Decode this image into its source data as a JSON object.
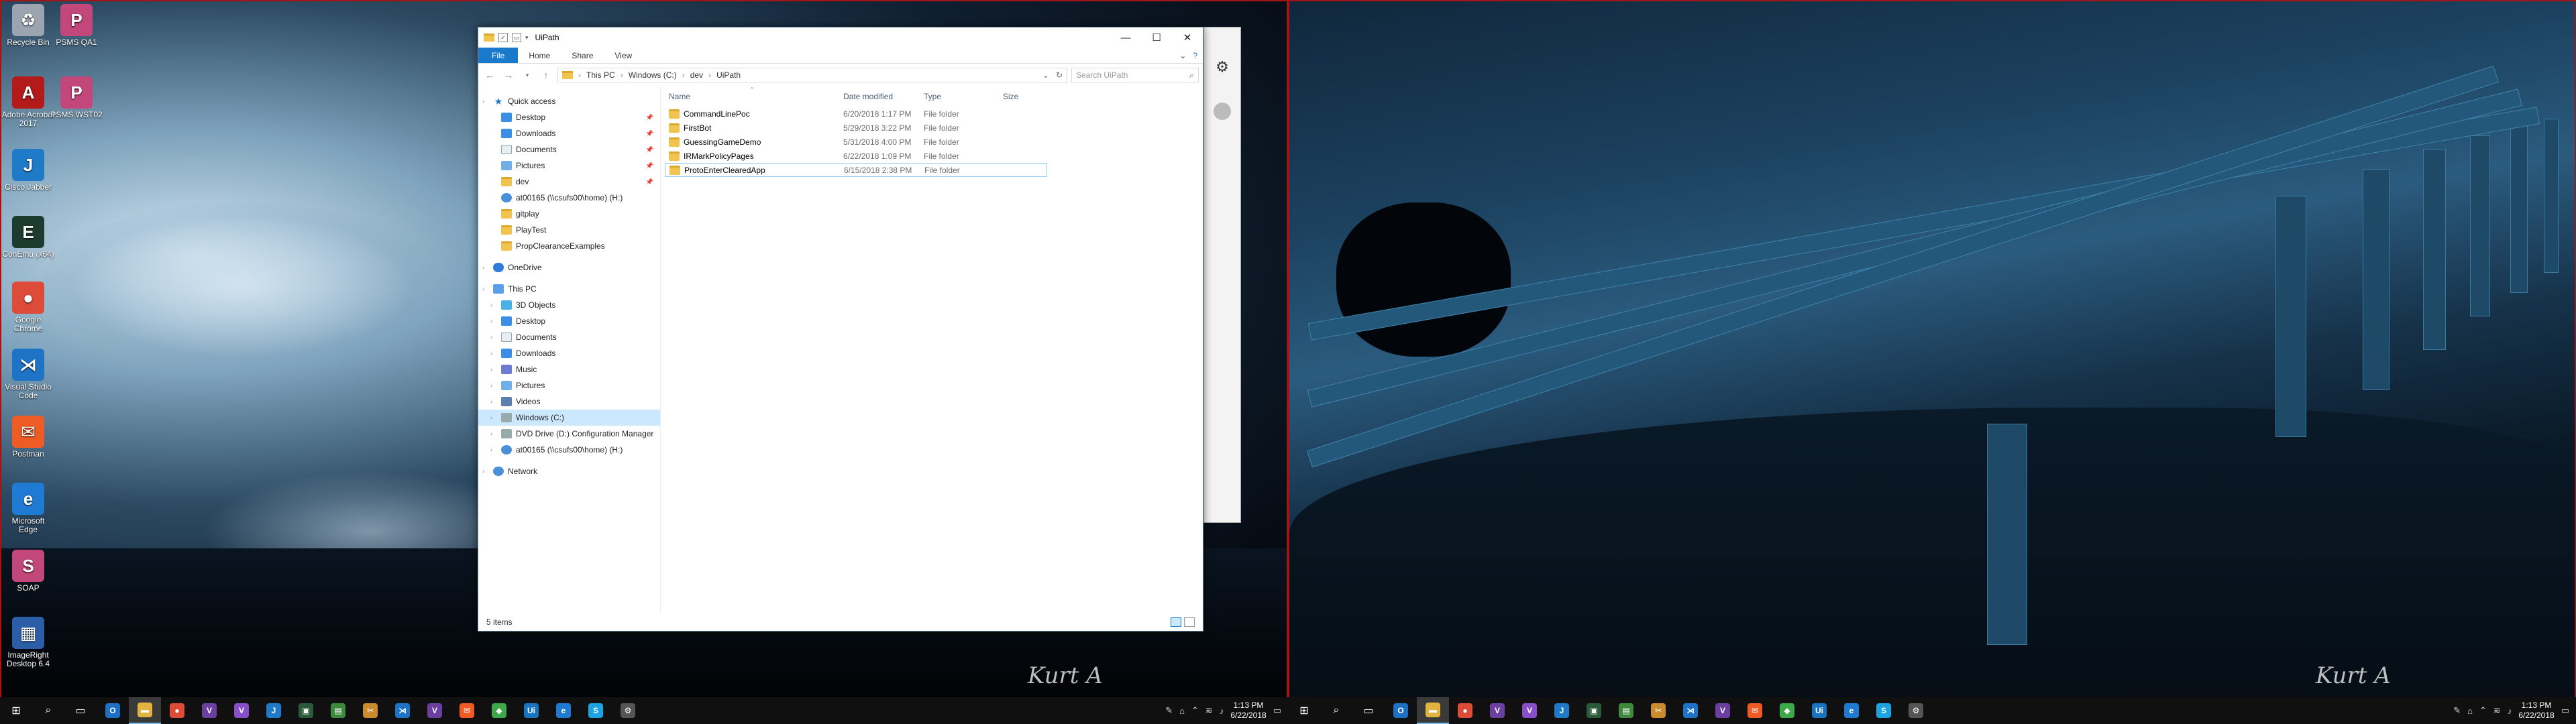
{
  "desktop_icons": [
    {
      "label": "Recycle Bin",
      "icon": "recycle-bin-icon",
      "color": "#9aa5b1",
      "glyph": "♻"
    },
    {
      "label": "PSMS QA1",
      "icon": "psms-icon",
      "color": "#c2477a",
      "glyph": "P"
    },
    {
      "label": "Adobe Acrobat 2017",
      "icon": "acrobat-icon",
      "color": "#b31b1b",
      "glyph": "A"
    },
    {
      "label": "PSMS WST02",
      "icon": "psms-icon",
      "color": "#c2477a",
      "glyph": "P"
    },
    {
      "label": "Cisco Jabber",
      "icon": "cisco-jabber-icon",
      "color": "#1f7ac8",
      "glyph": "J"
    },
    {
      "label": "ConEmu (x64)",
      "icon": "conemu-icon",
      "color": "#1d3b2f",
      "glyph": "E"
    },
    {
      "label": "Google Chrome",
      "icon": "chrome-icon",
      "color": "#dd4b39",
      "glyph": "●"
    },
    {
      "label": "Visual Studio Code",
      "icon": "vscode-icon",
      "color": "#1e73c7",
      "glyph": "⋊"
    },
    {
      "label": "Postman",
      "icon": "postman-icon",
      "color": "#ef5b25",
      "glyph": "✉"
    },
    {
      "label": "Microsoft Edge",
      "icon": "edge-icon",
      "color": "#1f7ad4",
      "glyph": "e"
    },
    {
      "label": "SOAP",
      "icon": "soap-icon",
      "color": "#c2477a",
      "glyph": "S"
    },
    {
      "label": "ImageRight Desktop 6.4",
      "icon": "imageright-icon",
      "color": "#2c5ea8",
      "glyph": "▦"
    }
  ],
  "explorer": {
    "title": "UiPath",
    "controls": {
      "minimize": "—",
      "maximize": "☐",
      "close": "✕"
    },
    "ribbon": {
      "file": "File",
      "home": "Home",
      "share": "Share",
      "view": "View"
    },
    "address": {
      "parts": [
        "This PC",
        "Windows (C:)",
        "dev",
        "UiPath"
      ]
    },
    "search": {
      "placeholder": "Search UiPath"
    },
    "nav": {
      "quick_access": "Quick access",
      "quick_items": [
        {
          "label": "Desktop",
          "icon": "blue",
          "pinned": true
        },
        {
          "label": "Downloads",
          "icon": "down",
          "pinned": true
        },
        {
          "label": "Documents",
          "icon": "doc",
          "pinned": true
        },
        {
          "label": "Pictures",
          "icon": "pic",
          "pinned": true
        },
        {
          "label": "dev",
          "icon": "fold",
          "pinned": true
        },
        {
          "label": "at00165 (\\\\csufs00\\home) (H:)",
          "icon": "net",
          "pinned": false
        },
        {
          "label": "gitplay",
          "icon": "fold",
          "pinned": false
        },
        {
          "label": "PlayTest",
          "icon": "fold",
          "pinned": false
        },
        {
          "label": "PropClearanceExamples",
          "icon": "fold",
          "pinned": false
        }
      ],
      "onedrive": "OneDrive",
      "this_pc": "This PC",
      "pc_items": [
        {
          "label": "3D Objects",
          "icon": "cube"
        },
        {
          "label": "Desktop",
          "icon": "blue"
        },
        {
          "label": "Documents",
          "icon": "doc"
        },
        {
          "label": "Downloads",
          "icon": "down"
        },
        {
          "label": "Music",
          "icon": "music"
        },
        {
          "label": "Pictures",
          "icon": "pic"
        },
        {
          "label": "Videos",
          "icon": "video"
        },
        {
          "label": "Windows (C:)",
          "icon": "drive",
          "selected": true
        },
        {
          "label": "DVD Drive (D:) Configuration Manager",
          "icon": "drive"
        },
        {
          "label": "at00165 (\\\\csufs00\\home) (H:)",
          "icon": "net"
        }
      ],
      "network": "Network"
    },
    "columns": {
      "name": "Name",
      "date": "Date modified",
      "type": "Type",
      "size": "Size"
    },
    "files": [
      {
        "name": "CommandLinePoc",
        "date": "6/20/2018 1:17 PM",
        "type": "File folder",
        "size": ""
      },
      {
        "name": "FirstBot",
        "date": "5/29/2018 3:22 PM",
        "type": "File folder",
        "size": ""
      },
      {
        "name": "GuessingGameDemo",
        "date": "5/31/2018 4:00 PM",
        "type": "File folder",
        "size": ""
      },
      {
        "name": "IRMarkPolicyPages",
        "date": "6/22/2018 1:09 PM",
        "type": "File folder",
        "size": ""
      },
      {
        "name": "ProtoEnterClearedApp",
        "date": "6/15/2018 2:38 PM",
        "type": "File folder",
        "size": ""
      }
    ],
    "status": "5 items"
  },
  "taskbar": {
    "clock_left": {
      "time": "1:13 PM",
      "date": "6/22/2018"
    },
    "clock_right": {
      "time": "1:13 PM",
      "date": "6/22/2018"
    }
  },
  "signature": "Kurt A"
}
